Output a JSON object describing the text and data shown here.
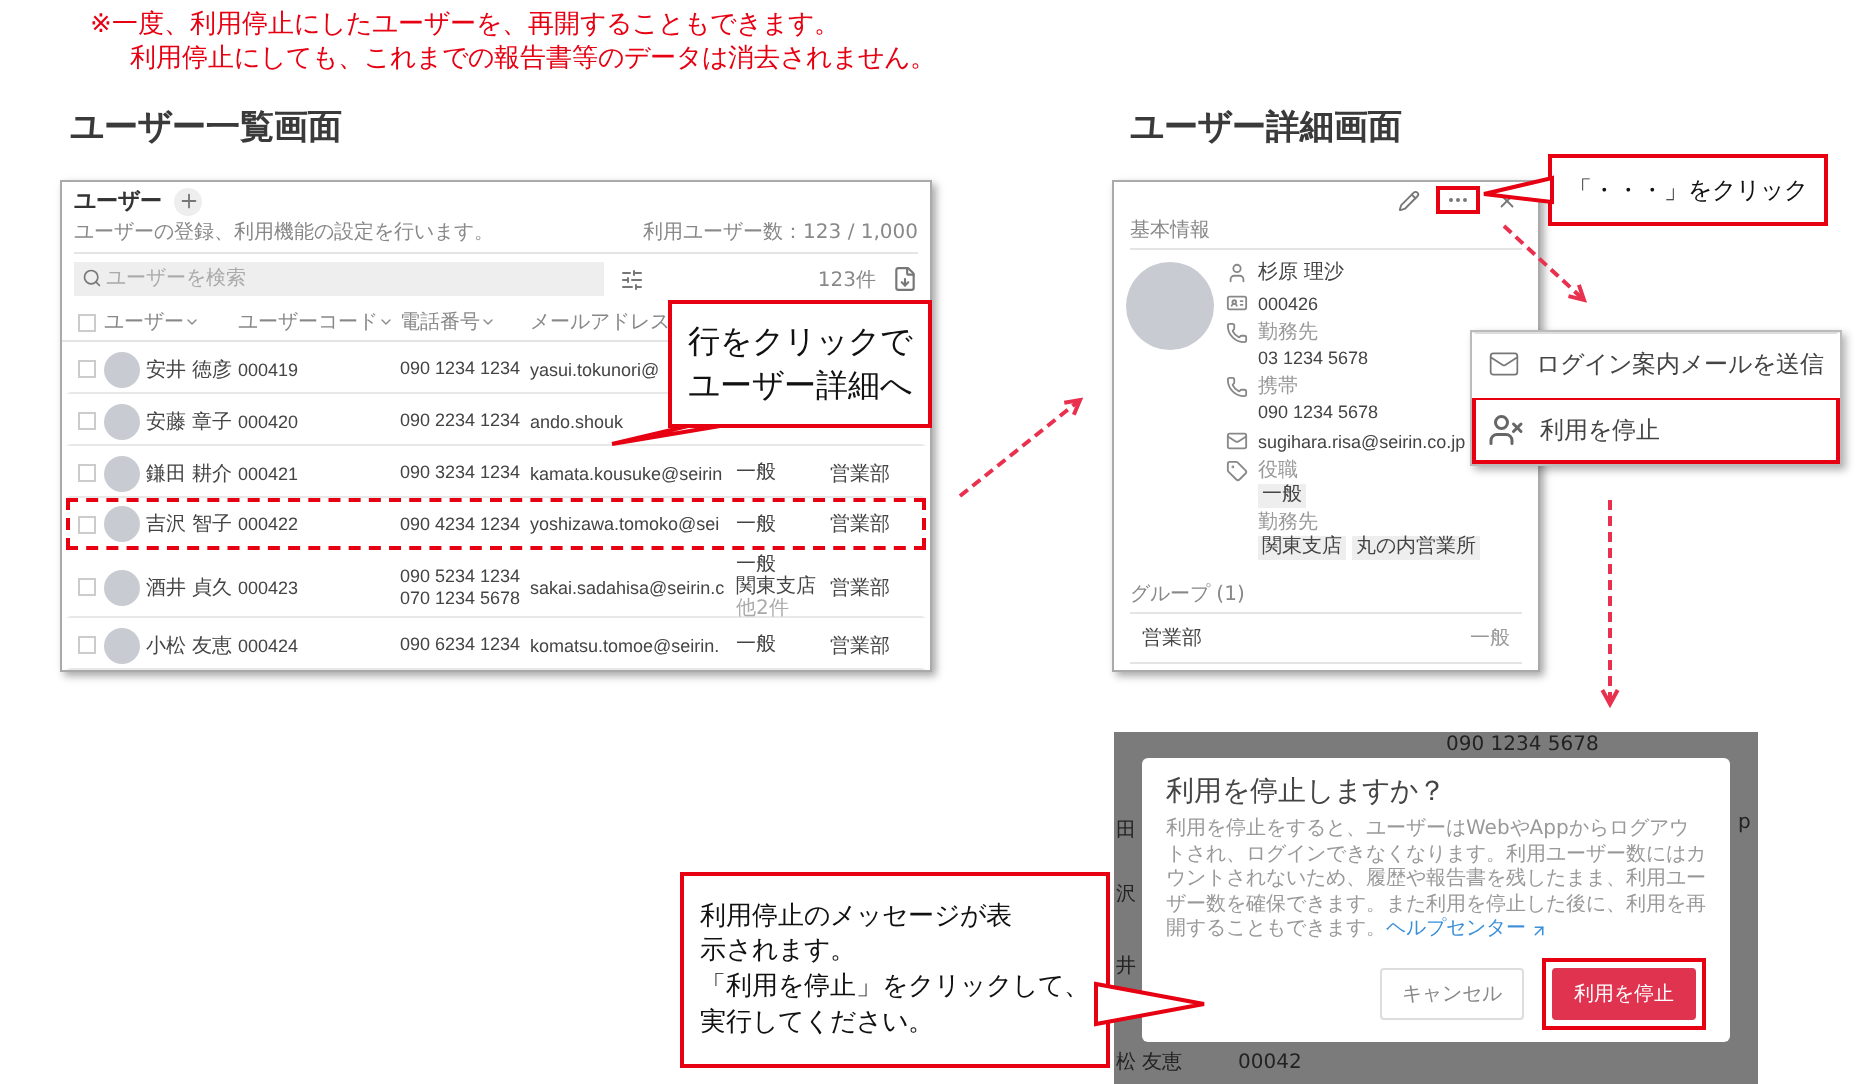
{
  "note": {
    "lines": [
      "※一度、利用停止にしたユーザーを、再開することもできます。",
      "利用停止にしても、これまでの報告書等のデータは消去されません。"
    ]
  },
  "list_screen": {
    "heading": "ユーザー一覧画面",
    "title": "ユーザー",
    "description": "ユーザーの登録、利用機能の設定を行います。",
    "usage": "利用ユーザー数：123 / 1,000",
    "search": {
      "placeholder": "ユーザーを検索"
    },
    "count": "123件",
    "select_all": {
      "checked": false
    },
    "columns": [
      "ユーザー",
      "ユーザーコード",
      "電話番号",
      "メールアドレス"
    ],
    "rows": [
      {
        "checked": false,
        "highlighted": false,
        "name": "安井 徳彦",
        "code": "000419",
        "phones": [
          "090 1234 1234"
        ],
        "email": "yasui.tokunori@"
      },
      {
        "checked": false,
        "highlighted": false,
        "name": "安藤 章子",
        "code": "000420",
        "phones": [
          "090 2234 1234"
        ],
        "email": "ando.shouk"
      },
      {
        "checked": false,
        "highlighted": false,
        "name": "鎌田 耕介",
        "code": "000421",
        "phones": [
          "090 3234 1234"
        ],
        "email": "kamata.kousuke@seirin",
        "roles": [
          "一般"
        ],
        "dept": "営業部"
      },
      {
        "checked": false,
        "highlighted": true,
        "name": "吉沢 智子",
        "code": "000422",
        "phones": [
          "090 4234 1234"
        ],
        "email": "yoshizawa.tomoko@sei",
        "roles": [
          "一般"
        ],
        "dept": "営業部"
      },
      {
        "checked": false,
        "highlighted": false,
        "name": "酒井 貞久",
        "code": "000423",
        "phones": [
          "090 5234 1234",
          "070 1234 5678"
        ],
        "email": "sakai.sadahisa@seirin.c",
        "roles": [
          "一般",
          "関東支店"
        ],
        "more": "他2件",
        "dept": "営業部"
      },
      {
        "checked": false,
        "highlighted": false,
        "name": "小松 友恵",
        "code": "000424",
        "phones": [
          "090 6234 1234"
        ],
        "email": "komatsu.tomoe@seirin.",
        "roles": [
          "一般"
        ],
        "dept": "営業部"
      }
    ]
  },
  "list_callout": {
    "lines": [
      "行をクリックで",
      "ユーザー詳細へ"
    ]
  },
  "detail_screen": {
    "heading": "ユーザー詳細画面",
    "more_button": {
      "highlighted": true
    },
    "section": "基本情報",
    "fields": [
      {
        "kind": "name",
        "value": "杉原 理沙"
      },
      {
        "kind": "code",
        "value": "000426"
      },
      {
        "kind": "phone",
        "label": "勤務先",
        "value": "03 1234 5678"
      },
      {
        "kind": "phone",
        "label": "携帯",
        "value": "090 1234 5678"
      },
      {
        "kind": "email",
        "value": "sugihara.risa@seirin.co.jp"
      },
      {
        "kind": "tags",
        "entries": [
          {
            "label": "役職",
            "tags": [
              "一般"
            ]
          },
          {
            "label": "勤務先",
            "tags": [
              "関東支店",
              "丸の内営業所"
            ]
          }
        ]
      }
    ],
    "groups_title": "グループ (1)",
    "groups": [
      {
        "name": "営業部",
        "role": "一般"
      }
    ]
  },
  "detail_callout": {
    "text": "「・・・」をクリック"
  },
  "menu": {
    "items": [
      {
        "kind": "mail",
        "label": "ログイン案内メールを送信",
        "highlighted": false
      },
      {
        "kind": "suspend",
        "label": "利用を停止",
        "highlighted": true
      }
    ]
  },
  "dialog": {
    "backdrop": [
      "090 1234 5678",
      "田",
      "沢",
      "井",
      "松 友恵",
      "00042",
      "p"
    ],
    "title": "利用を停止しますか？",
    "body": "利用を停止をすると、ユーザーはWebやAppからログアウトされ、ログインできなくなります。利用ユーザー数にはカウントされないため、履歴や報告書を残したまま、利用ユーザー数を確保できます。また利用を停止した後に、利用を再開することもできます。",
    "link": "ヘルプセンター",
    "buttons": [
      {
        "kind": "secondary",
        "label": "キャンセル",
        "highlighted": false
      },
      {
        "kind": "danger",
        "label": "利用を停止",
        "highlighted": true
      }
    ]
  },
  "dialog_callout": {
    "lines": [
      "利用停止のメッセージが表",
      "示されます。",
      "「利用を停止」をクリックして、",
      "実行してください。"
    ]
  }
}
